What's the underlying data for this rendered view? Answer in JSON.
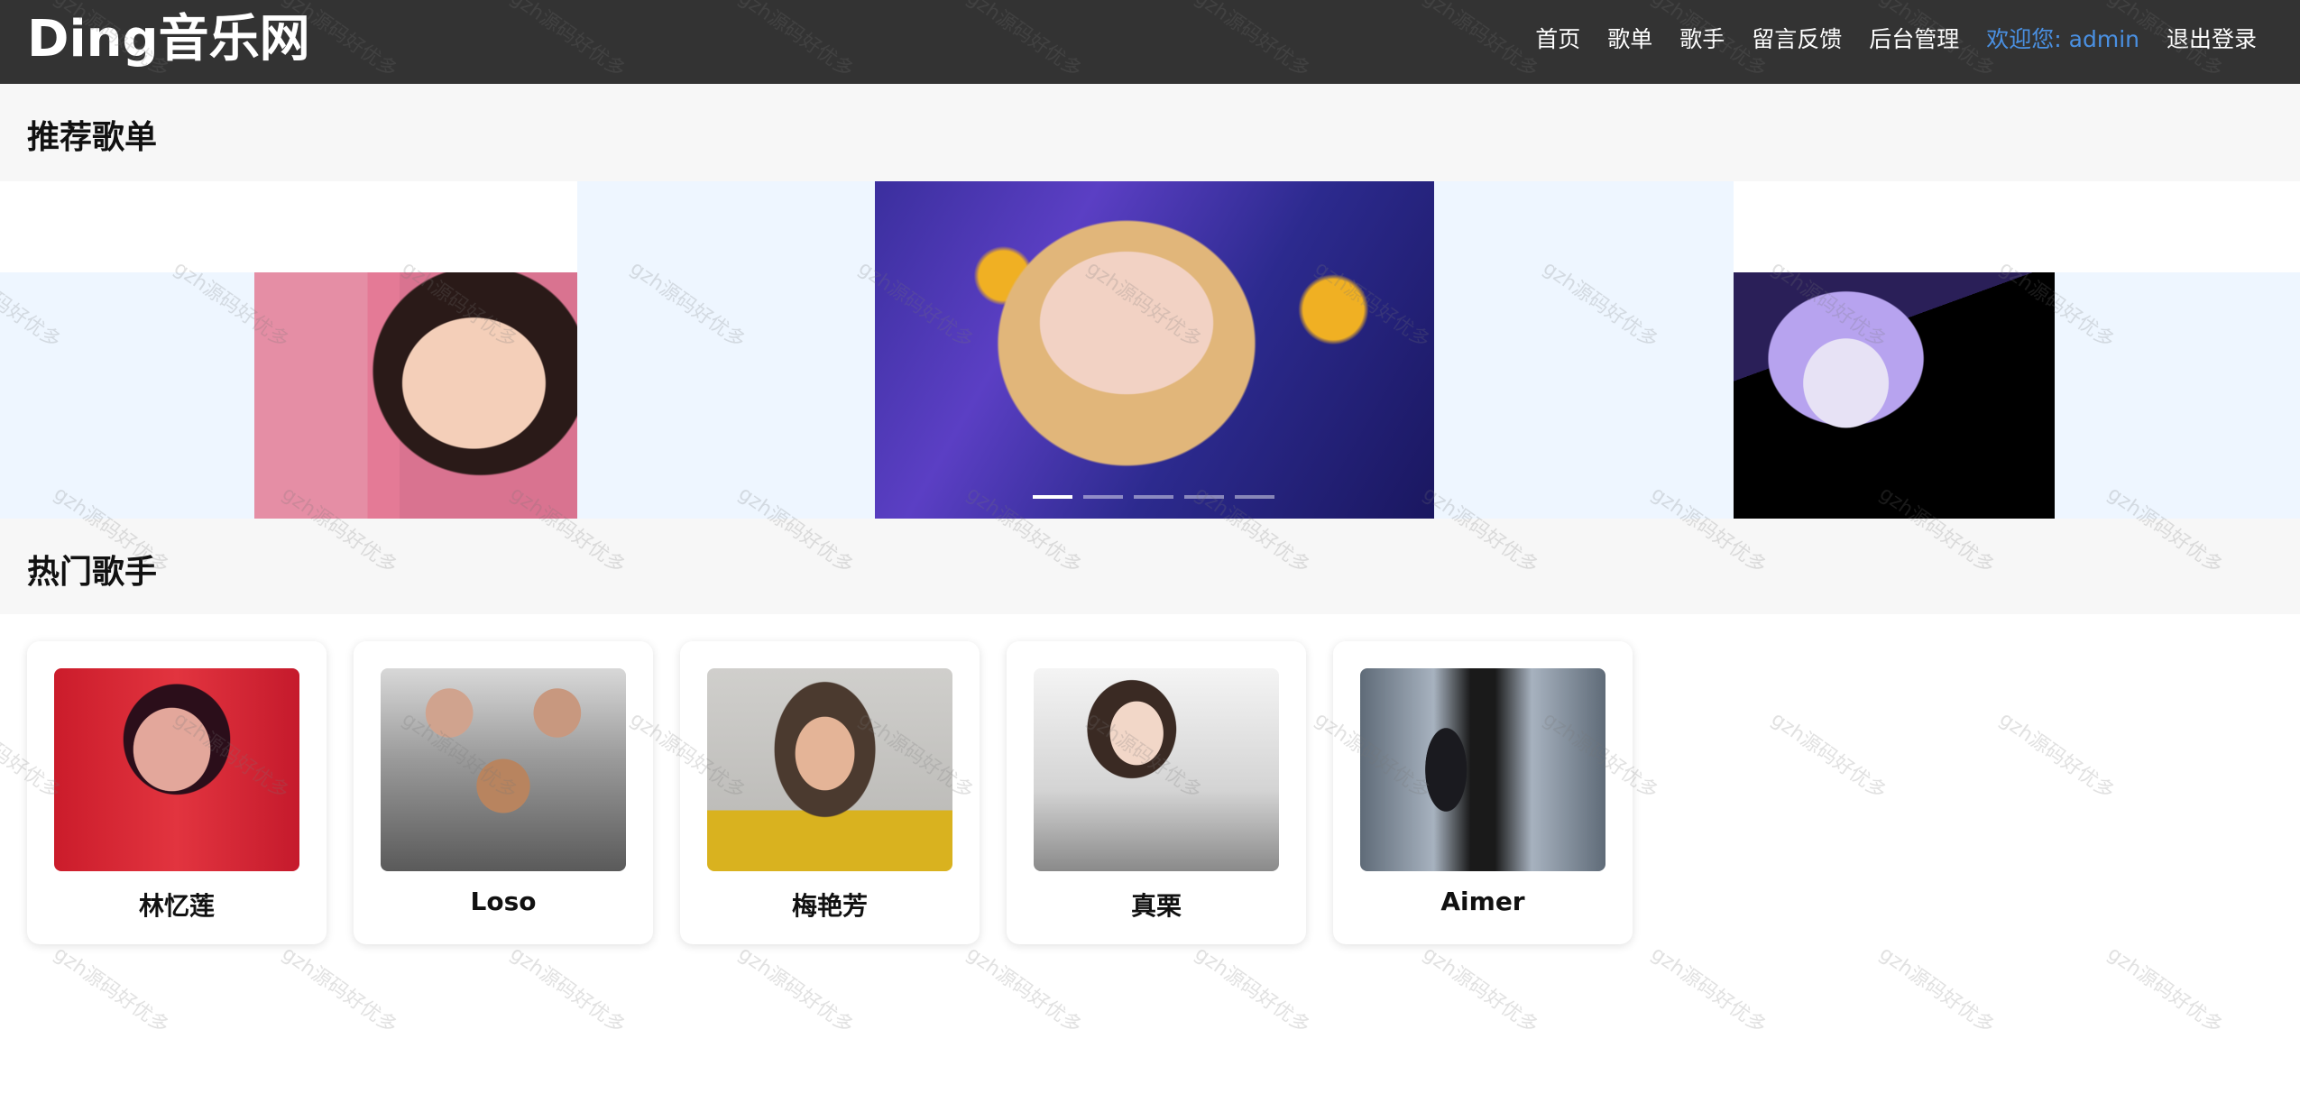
{
  "header": {
    "brand": "Ding音乐网",
    "nav": [
      {
        "label": "首页"
      },
      {
        "label": "歌单"
      },
      {
        "label": "歌手"
      },
      {
        "label": "留言反馈"
      },
      {
        "label": "后台管理"
      }
    ],
    "welcome": "欢迎您: admin",
    "logout": "退出登录",
    "colors": {
      "bar": "#333333",
      "welcome": "#4a90e2"
    }
  },
  "recommend": {
    "title": "推荐歌单",
    "slides": [
      {
        "desc": "pink-wall-portrait"
      },
      {
        "desc": "headphones-portrait"
      },
      {
        "desc": "anime-character"
      }
    ],
    "indicators": 5,
    "active_indicator": 1
  },
  "hot_singers": {
    "title": "热门歌手",
    "items": [
      {
        "name": "林忆莲"
      },
      {
        "name": "Loso"
      },
      {
        "name": "梅艳芳"
      },
      {
        "name": "真栗"
      },
      {
        "name": "Aimer"
      }
    ]
  },
  "watermark": "gzh源码好优多"
}
